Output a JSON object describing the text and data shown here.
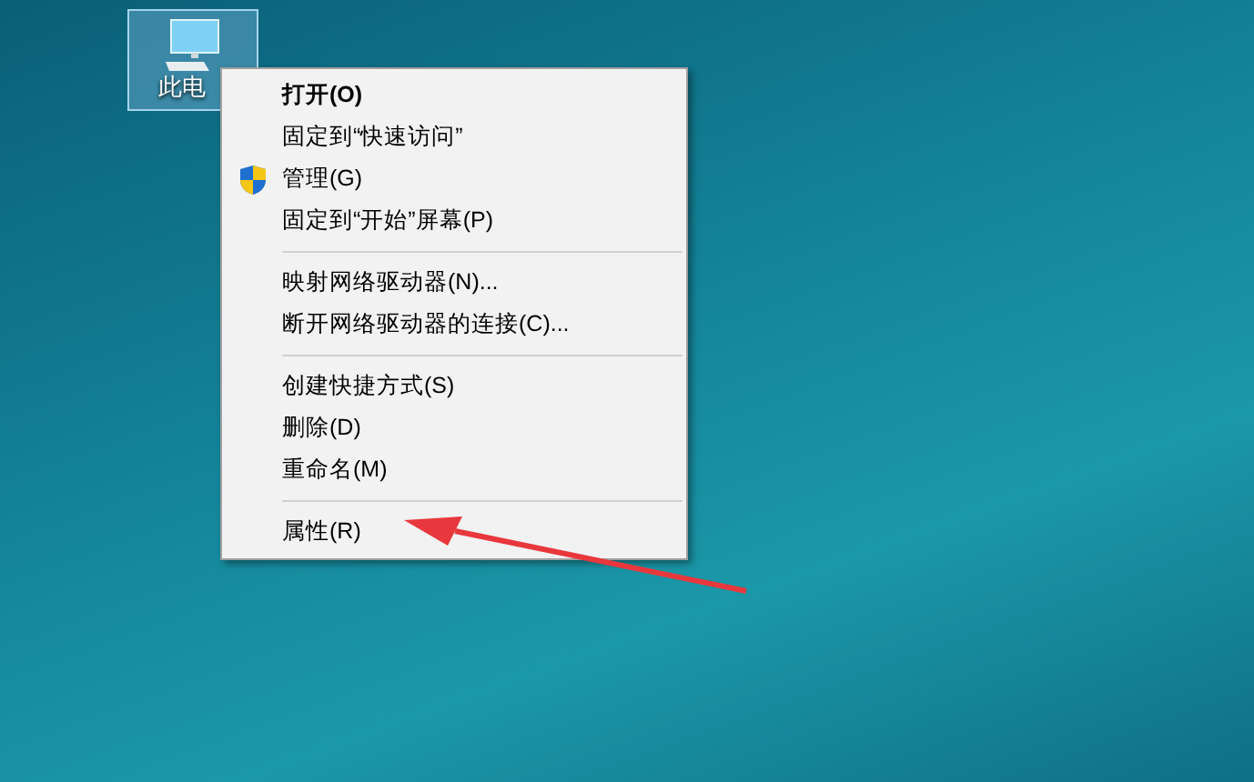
{
  "desktop_icons": [
    {
      "label": "此电",
      "selected": true
    }
  ],
  "context_menu": {
    "groups": [
      [
        {
          "label": "打开(O)",
          "kind": "plain",
          "default": true
        },
        {
          "label": "固定到“快速访问”",
          "kind": "plain",
          "default": false
        },
        {
          "label": "管理(G)",
          "kind": "shield",
          "default": false
        },
        {
          "label": "固定到“开始”屏幕(P)",
          "kind": "plain",
          "default": false
        }
      ],
      [
        {
          "label": "映射网络驱动器(N)...",
          "kind": "plain",
          "default": false
        },
        {
          "label": "断开网络驱动器的连接(C)...",
          "kind": "plain",
          "default": false
        }
      ],
      [
        {
          "label": "创建快捷方式(S)",
          "kind": "plain",
          "default": false
        },
        {
          "label": "删除(D)",
          "kind": "plain",
          "default": false
        },
        {
          "label": "重命名(M)",
          "kind": "plain",
          "default": false
        }
      ],
      [
        {
          "label": "属性(R)",
          "kind": "plain",
          "default": false
        }
      ]
    ]
  }
}
